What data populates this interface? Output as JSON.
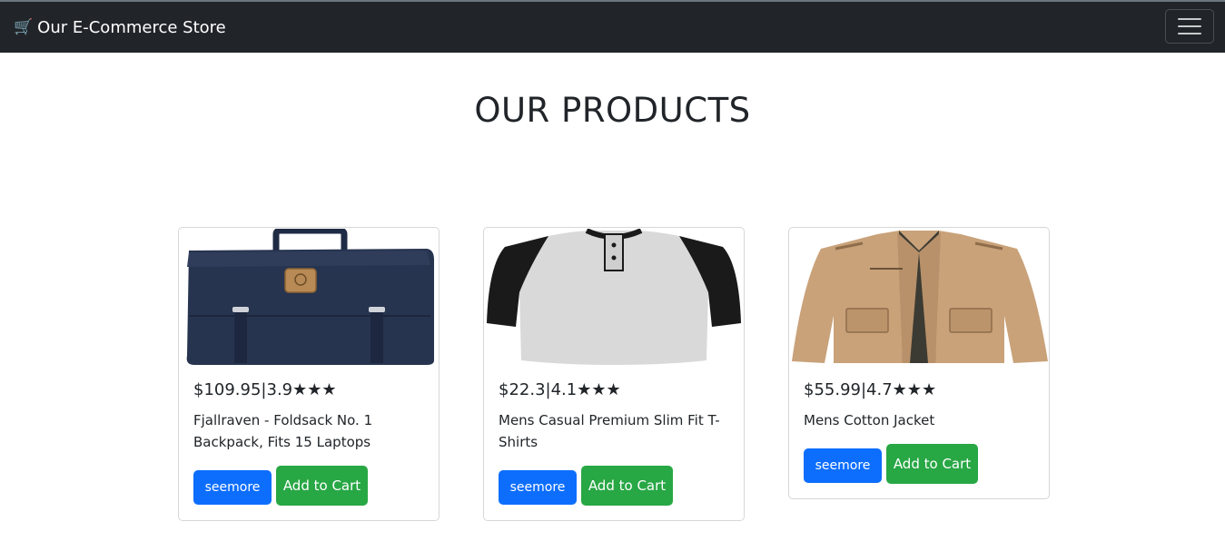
{
  "navbar": {
    "brand_icon": "🛒",
    "brand_text": "Our E-Commerce Store",
    "toggler_icon": "hamburger-menu-icon"
  },
  "page": {
    "title": "OUR PRODUCTS"
  },
  "products": [
    {
      "price_rating": "$109.95|3.9★★★",
      "title": "Fjallraven - Foldsack No. 1 Backpack, Fits 15 Laptops",
      "image": "navy-backpack-image",
      "seemore_label": "seemore",
      "add_label": "Add to Cart"
    },
    {
      "price_rating": "$22.3|4.1★★★",
      "title": "Mens Casual Premium Slim Fit T-Shirts",
      "image": "raglan-tshirt-image",
      "seemore_label": "seemore",
      "add_label": "Add to Cart"
    },
    {
      "price_rating": "$55.99|4.7★★★",
      "title": "Mens Cotton Jacket",
      "image": "khaki-jacket-image",
      "seemore_label": "seemore",
      "add_label": "Add to Cart"
    }
  ],
  "colors": {
    "navbar_bg": "#212529",
    "seemore_bg": "#0d6efd",
    "add_to_cart_bg": "#28a745"
  }
}
